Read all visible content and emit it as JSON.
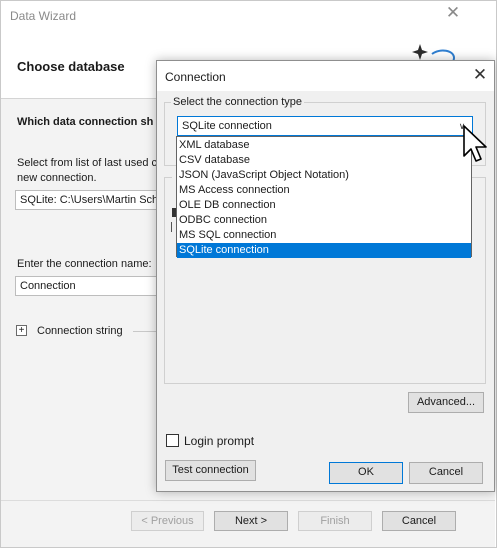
{
  "wizard": {
    "title": "Data Wizard",
    "close_glyph": "✕",
    "heading": "Choose database",
    "question": "Which data connection sh",
    "last_used_text": "Select from list of last used c new connection.",
    "last_used_value": "SQLite: C:\\Users\\Martin Sch",
    "conn_name_label": "Enter the connection name:",
    "conn_name_value": "Connection",
    "expand_glyph": "+",
    "conn_string_label": "Connection string",
    "buttons": {
      "previous": "< Previous",
      "next": "Next >",
      "finish": "Finish",
      "cancel": "Cancel"
    }
  },
  "dialog": {
    "title": "Connection",
    "close_glyph": "✕",
    "type_group_label": "Select the connection type",
    "selected_type": "SQLite connection",
    "combo_arrow_glyph": "∨",
    "options": [
      "XML database",
      "CSV database",
      "JSON (JavaScript Object Notation)",
      "MS Access connection",
      "OLE DB connection",
      "ODBC connection",
      "MS SQL connection",
      "SQLite connection"
    ],
    "selected_index": 7,
    "advanced_label": "Advanced...",
    "login_prompt_label": "Login prompt",
    "login_prompt_checked": false,
    "test_label": "Test connection",
    "ok_label": "OK",
    "cancel_label": "Cancel"
  },
  "icons": {
    "sparkle": "sparkle-icon",
    "cursor": "arrow-cursor-icon",
    "expand": "plus-box-icon"
  },
  "colors": {
    "accent": "#0078d7",
    "dialog_bg": "#f0f0f0",
    "wizard_body_bg": "#f3f3f3"
  }
}
